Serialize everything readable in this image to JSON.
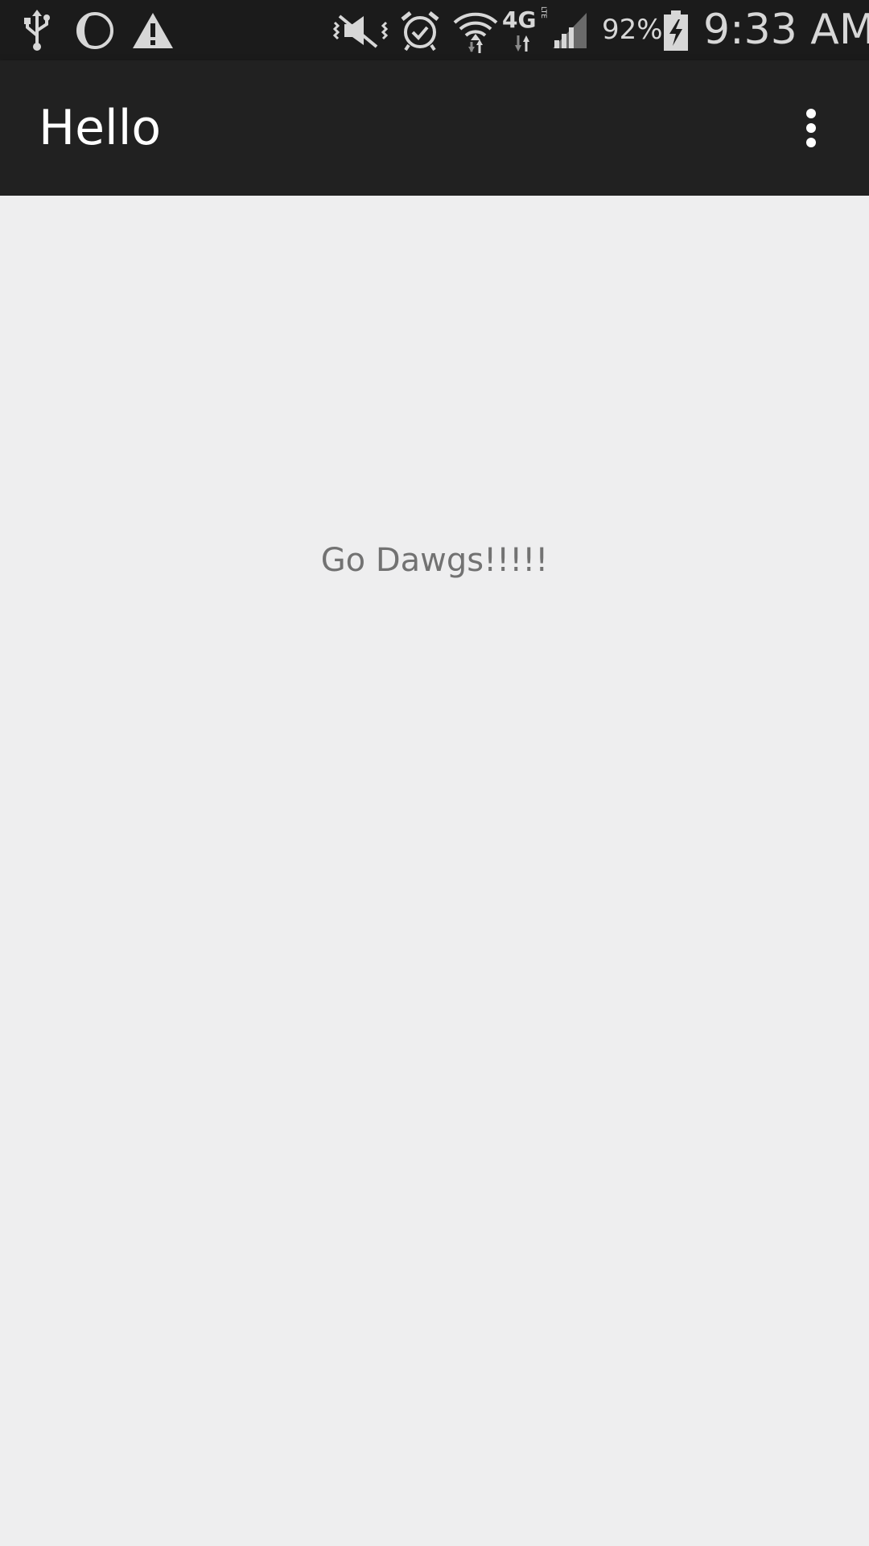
{
  "status_bar": {
    "icons_left": [
      "usb-icon",
      "brightness-icon",
      "warning-icon"
    ],
    "icons_right": [
      "mute-vibrate-icon",
      "alarm-icon",
      "wifi-icon",
      "4g-lte-icon",
      "signal-icon",
      "battery-charging-icon"
    ],
    "network_label": "4G",
    "network_sub_label": "LTE",
    "battery_percent": "92%",
    "time": "9:33 AM"
  },
  "app_bar": {
    "title": "Hello",
    "overflow_icon": "more-vert-icon"
  },
  "main": {
    "text": "Go Dawgs!!!!!"
  },
  "colors": {
    "status_bar_bg": "#1b1b1b",
    "app_bar_bg": "#212121",
    "content_bg": "#eeeeef",
    "main_text": "#727272"
  }
}
